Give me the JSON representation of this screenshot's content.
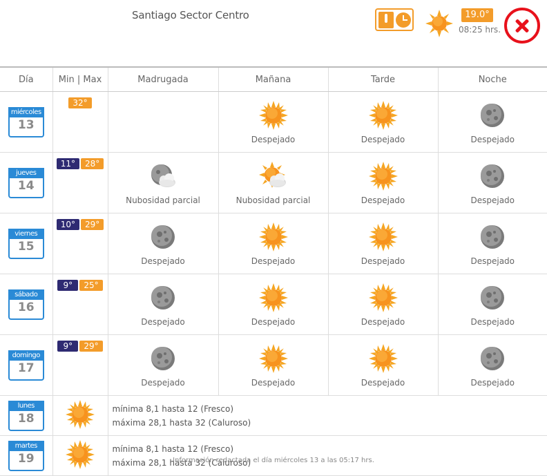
{
  "header": {
    "location": "Santiago Sector Centro",
    "current_temp": "19.0°",
    "current_time": "08:25 hrs."
  },
  "table": {
    "headers": [
      "Día",
      "Min | Max",
      "Madrugada",
      "Mañana",
      "Tarde",
      "Noche"
    ],
    "days": [
      {
        "weekday": "miércoles",
        "day": "13",
        "min": "",
        "max": "32°",
        "periods": [
          {
            "icon": "",
            "label": ""
          },
          {
            "icon": "sun",
            "label": "Despejado"
          },
          {
            "icon": "sun",
            "label": "Despejado"
          },
          {
            "icon": "moon",
            "label": "Despejado"
          }
        ]
      },
      {
        "weekday": "jueves",
        "day": "14",
        "min": "11°",
        "max": "28°",
        "periods": [
          {
            "icon": "moon-cloud",
            "label": "Nubosidad parcial"
          },
          {
            "icon": "sun-cloud",
            "label": "Nubosidad parcial"
          },
          {
            "icon": "sun",
            "label": "Despejado"
          },
          {
            "icon": "moon",
            "label": "Despejado"
          }
        ]
      },
      {
        "weekday": "viernes",
        "day": "15",
        "min": "10°",
        "max": "29°",
        "periods": [
          {
            "icon": "moon",
            "label": "Despejado"
          },
          {
            "icon": "sun",
            "label": "Despejado"
          },
          {
            "icon": "sun",
            "label": "Despejado"
          },
          {
            "icon": "moon",
            "label": "Despejado"
          }
        ]
      },
      {
        "weekday": "sábado",
        "day": "16",
        "min": "9°",
        "max": "25°",
        "periods": [
          {
            "icon": "moon",
            "label": "Despejado"
          },
          {
            "icon": "sun",
            "label": "Despejado"
          },
          {
            "icon": "sun",
            "label": "Despejado"
          },
          {
            "icon": "moon",
            "label": "Despejado"
          }
        ]
      },
      {
        "weekday": "domingo",
        "day": "17",
        "min": "9°",
        "max": "29°",
        "periods": [
          {
            "icon": "moon",
            "label": "Despejado"
          },
          {
            "icon": "sun",
            "label": "Despejado"
          },
          {
            "icon": "sun",
            "label": "Despejado"
          },
          {
            "icon": "moon",
            "label": "Despejado"
          }
        ]
      }
    ],
    "extended": [
      {
        "weekday": "lunes",
        "day": "18",
        "icon": "sun",
        "line1": "mínima 8,1 hasta 12 (Fresco)",
        "line2": "máxima 28,1 hasta 32 (Caluroso)"
      },
      {
        "weekday": "martes",
        "day": "19",
        "icon": "sun",
        "line1": "mínima 8,1 hasta 12 (Fresco)",
        "line2": "máxima 28,1 hasta 32 (Caluroso)"
      }
    ]
  },
  "footer": {
    "text": "Información redactada el día miércoles 13 a las 05:17 hrs."
  },
  "colors": {
    "accent_orange": "#f39c2a",
    "min_navy": "#2e2a72",
    "date_blue": "#2a8ad6",
    "close_red": "#e8111b"
  }
}
